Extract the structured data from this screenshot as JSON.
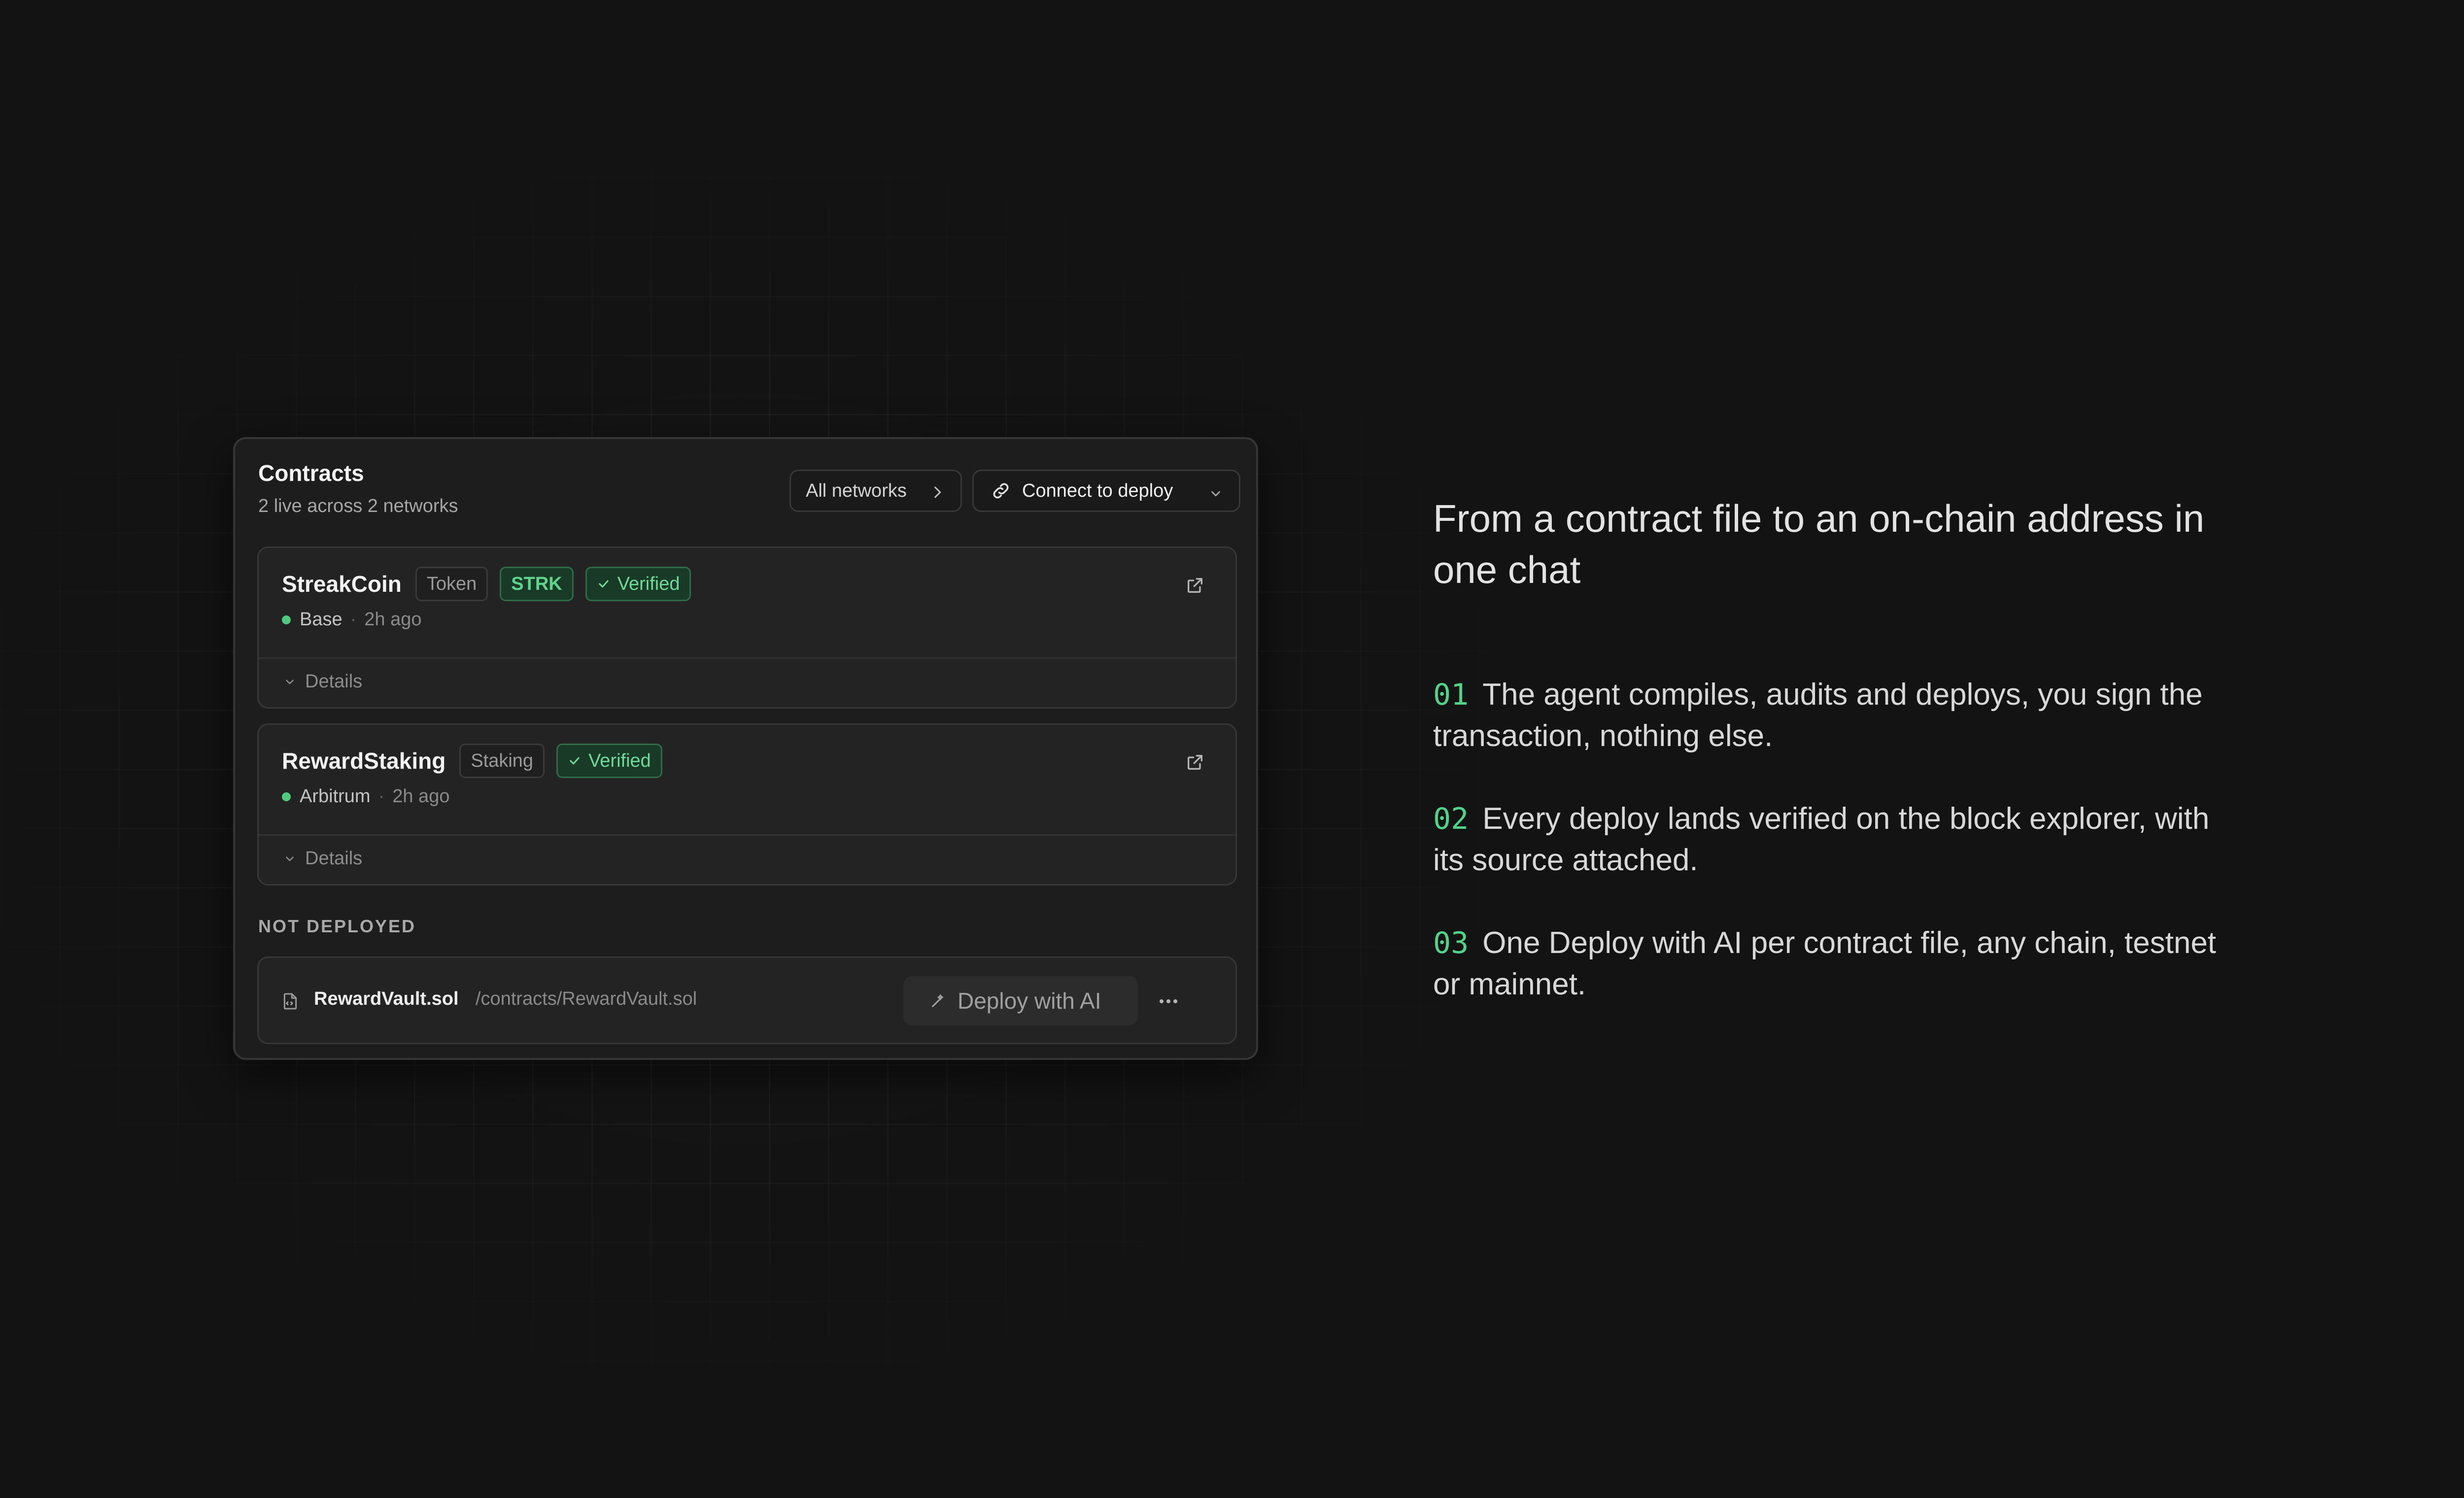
{
  "panel": {
    "title": "Contracts",
    "subtitle": "2 live across 2 networks",
    "networks_label": "All networks",
    "connect_label": "Connect to deploy"
  },
  "contracts": [
    {
      "name": "StreakCoin",
      "type": "Token",
      "symbol": "STRK",
      "verified": "Verified",
      "network": "Base",
      "time": "2h ago",
      "details": "Details"
    },
    {
      "name": "RewardStaking",
      "type": "Staking",
      "verified": "Verified",
      "network": "Arbitrum",
      "time": "2h ago",
      "details": "Details"
    }
  ],
  "not_deployed": {
    "label": "NOT DEPLOYED",
    "file_name": "RewardVault.sol",
    "file_path": "/contracts/RewardVault.sol",
    "deploy_label": "Deploy with AI",
    "more": "···"
  },
  "copy": {
    "headline": "From a contract file to an on-chain address in one chat",
    "points": [
      {
        "num": "01",
        "text": "The agent compiles, audits and deploys, you sign the transaction, nothing else."
      },
      {
        "num": "02",
        "text": "Every deploy lands verified on the block explorer, with its source attached."
      },
      {
        "num": "03",
        "text": "One Deploy with AI per contract file, any chain, testnet or mainnet."
      }
    ]
  },
  "colors": {
    "accent_green": "#4fd48a",
    "status_dot": "#4fc97e",
    "background": "#131313",
    "panel": "#1d1d1d"
  },
  "icons": [
    "chevron-right-icon",
    "link-icon",
    "chevron-down-icon",
    "check-icon",
    "external-link-icon",
    "file-icon",
    "wand-icon",
    "more-icon"
  ]
}
